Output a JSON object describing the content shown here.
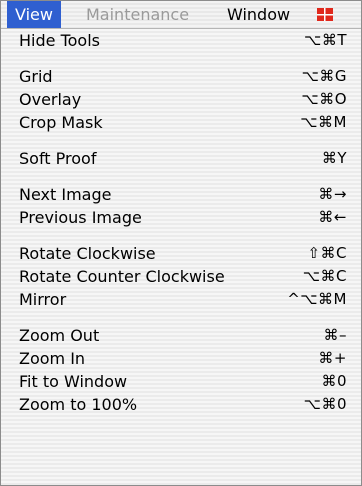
{
  "menubar": {
    "view": "View",
    "maintenance": "Maintenance",
    "window": "Window",
    "flag_icon": "flag-icon"
  },
  "menu": {
    "groups": [
      [
        {
          "label": "Hide Tools",
          "shortcut": "⌥⌘T"
        }
      ],
      [
        {
          "label": "Grid",
          "shortcut": "⌥⌘G"
        },
        {
          "label": "Overlay",
          "shortcut": "⌥⌘O"
        },
        {
          "label": "Crop Mask",
          "shortcut": "⌥⌘M"
        }
      ],
      [
        {
          "label": "Soft Proof",
          "shortcut": "⌘Y"
        }
      ],
      [
        {
          "label": "Next Image",
          "shortcut": "⌘→"
        },
        {
          "label": "Previous Image",
          "shortcut": "⌘←"
        }
      ],
      [
        {
          "label": "Rotate Clockwise",
          "shortcut": "⇧⌘C"
        },
        {
          "label": "Rotate Counter Clockwise",
          "shortcut": "⌥⌘C"
        },
        {
          "label": "Mirror",
          "shortcut": "^⌥⌘M"
        }
      ],
      [
        {
          "label": "Zoom Out",
          "shortcut": "⌘–"
        },
        {
          "label": "Zoom In",
          "shortcut": "⌘+"
        },
        {
          "label": "Fit to Window",
          "shortcut": "⌘0"
        },
        {
          "label": "Zoom to 100%",
          "shortcut": "⌥⌘0"
        }
      ]
    ]
  },
  "colors": {
    "highlight": "#2f5fd0",
    "disabled_text": "#9a9a9a",
    "flag_red": "#e0281c"
  }
}
